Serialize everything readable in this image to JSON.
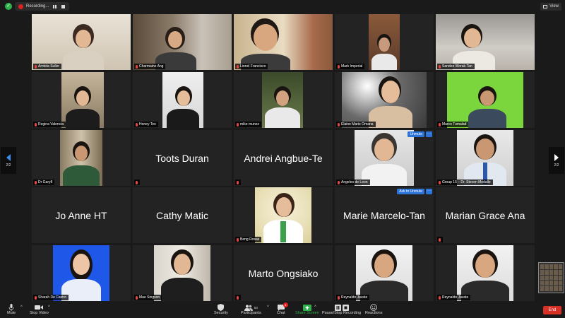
{
  "topbar": {
    "recording_label": "Recording...",
    "view_label": "View"
  },
  "tiles": {
    "armida": {
      "name": "Armida Suller"
    },
    "charmaine": {
      "name": "Charmaine Ang"
    },
    "lionel": {
      "name": "Lionel Francisco"
    },
    "mark": {
      "name": "Mark Imperial"
    },
    "sandee": {
      "name": "Sandee Worak-Tan"
    },
    "regina": {
      "name": "Regina Valencia"
    },
    "honey": {
      "name": "Honey Teo"
    },
    "mike": {
      "name": "mike munoz"
    },
    "elaine": {
      "name": "Elaine Marie Omana"
    },
    "marco": {
      "name": "Marco Tumalad"
    },
    "gary": {
      "name": "Dr Gary8"
    },
    "toots": {
      "name": "Toots Duran",
      "tag": ""
    },
    "andrei": {
      "name": "Andrei Angbue-Te"
    },
    "angeles": {
      "name": "Angeles de Leon",
      "badge": "Unmute",
      "more": "···"
    },
    "group15": {
      "name": "Group 15 – Dr. Steven Medalle"
    },
    "joanne": {
      "name": "Jo Anne HT"
    },
    "cathy": {
      "name": "Cathy Matic"
    },
    "beng": {
      "name": "Beng Rosas"
    },
    "marie": {
      "name": "Marie Marcelo-Tan",
      "badge": "Ask to Unmute",
      "more": "···"
    },
    "marian": {
      "name": "Marian Grace Ana"
    },
    "sharah": {
      "name": "Sharah De Castro"
    },
    "mae": {
      "name": "Mae Singson"
    },
    "marto": {
      "name": "Marto Ongsiako"
    },
    "reynaldo1": {
      "name": "Reynaldo Javate"
    },
    "reynaldo2": {
      "name": "Reynaldo Javate"
    }
  },
  "pager": {
    "left": "2/2",
    "right": "2/2"
  },
  "toolbar": {
    "mute": "Mute",
    "stop_video": "Stop Video",
    "security": "Security",
    "participants": "Participants",
    "participants_count": "53",
    "chat": "Chat",
    "chat_badge": "1",
    "share_screen": "Share Screen",
    "record": "Pause/Stop Recording",
    "reactions": "Reactions",
    "end": "End"
  }
}
